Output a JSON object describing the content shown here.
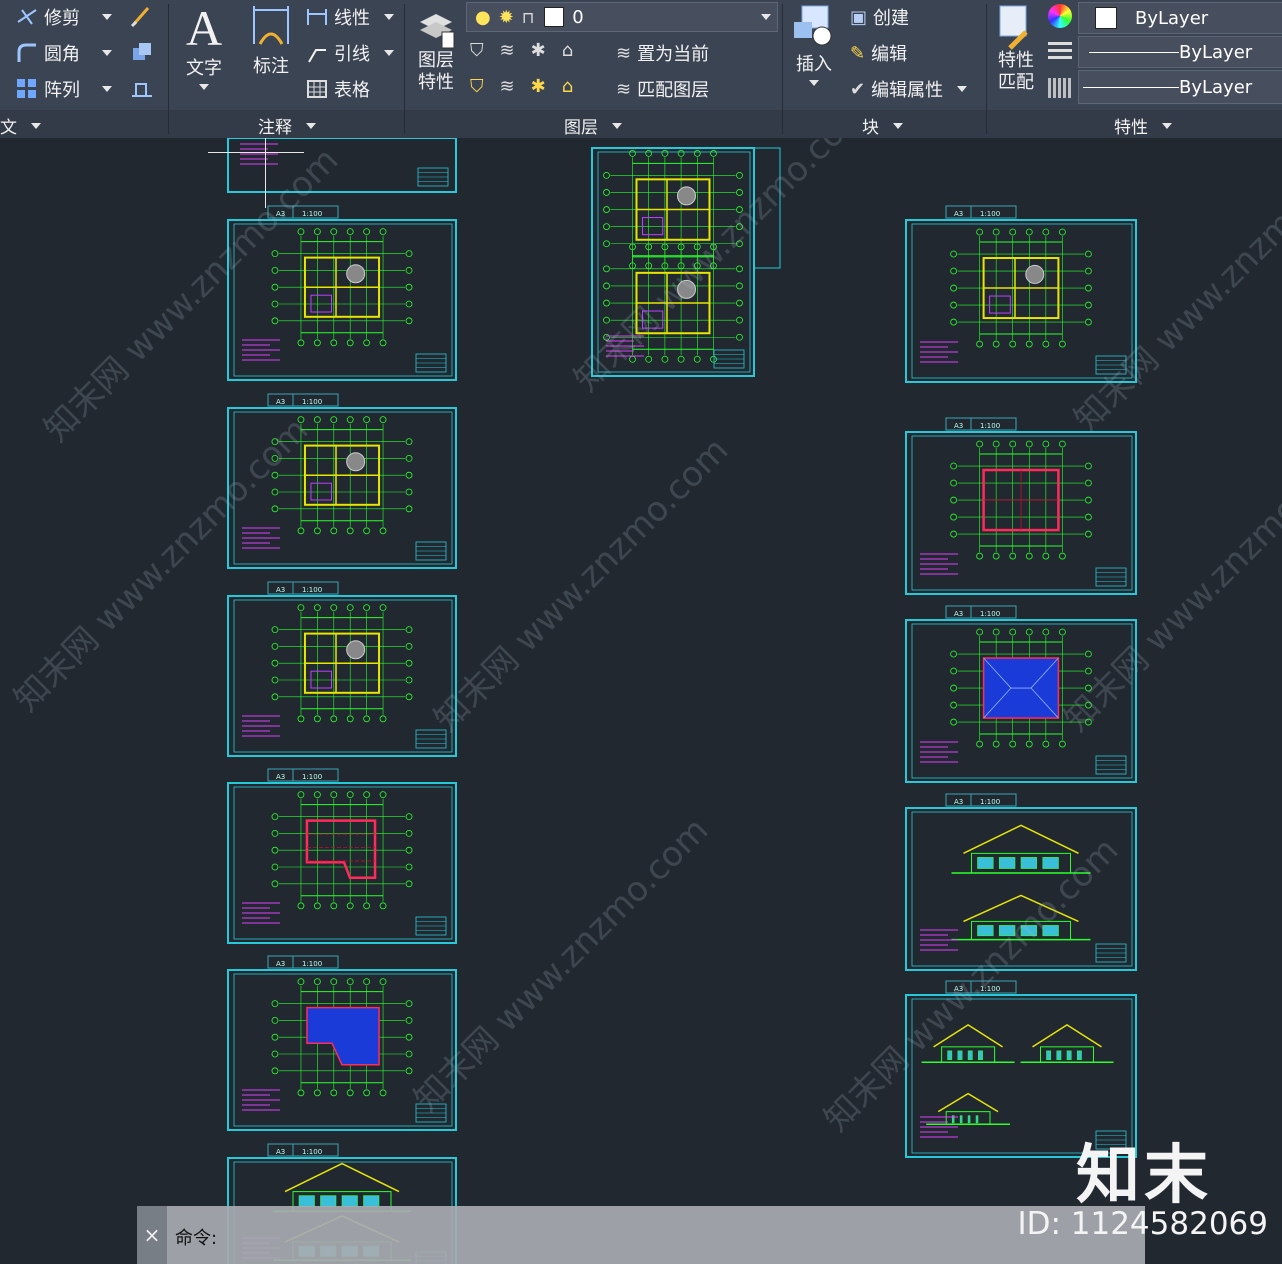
{
  "ribbon": {
    "modify": {
      "trim": "修剪",
      "fillet": "圆角",
      "array": "阵列",
      "panel_label_partial": "文"
    },
    "annotation": {
      "text": "文字",
      "dimension": "标注",
      "linetype": "线性",
      "leader": "引线",
      "table": "表格",
      "panel_label": "注释"
    },
    "layers": {
      "layer_properties": "图层\n特性",
      "current_layer": "0",
      "set_current": "置为当前",
      "match_layer": "匹配图层",
      "panel_label": "图层"
    },
    "block": {
      "insert": "插入",
      "create": "创建",
      "edit": "编辑",
      "edit_attributes": "编辑属性",
      "panel_label": "块"
    },
    "properties": {
      "match_properties": "特性\n匹配",
      "color": "ByLayer",
      "lineweight": "ByLayer",
      "linetype": "ByLayer",
      "panel_label": "特性"
    }
  },
  "sheets": {
    "tab_size": "A3",
    "tab_scale": "1:100"
  },
  "watermark": {
    "text": "知末网 www.znzmo.com"
  },
  "command": {
    "prompt": "命令:",
    "close": "×"
  },
  "brand": {
    "logo": "知末",
    "id": "ID: 1124582069"
  },
  "colors": {
    "background": "#212830",
    "sheet_border": "#27c8d8",
    "lines": "#2bff2b",
    "walls": "#e6e600",
    "accent_red": "#ff2b5a",
    "fill_blue": "#1a3bd8",
    "ribbon": "#3b4453"
  }
}
